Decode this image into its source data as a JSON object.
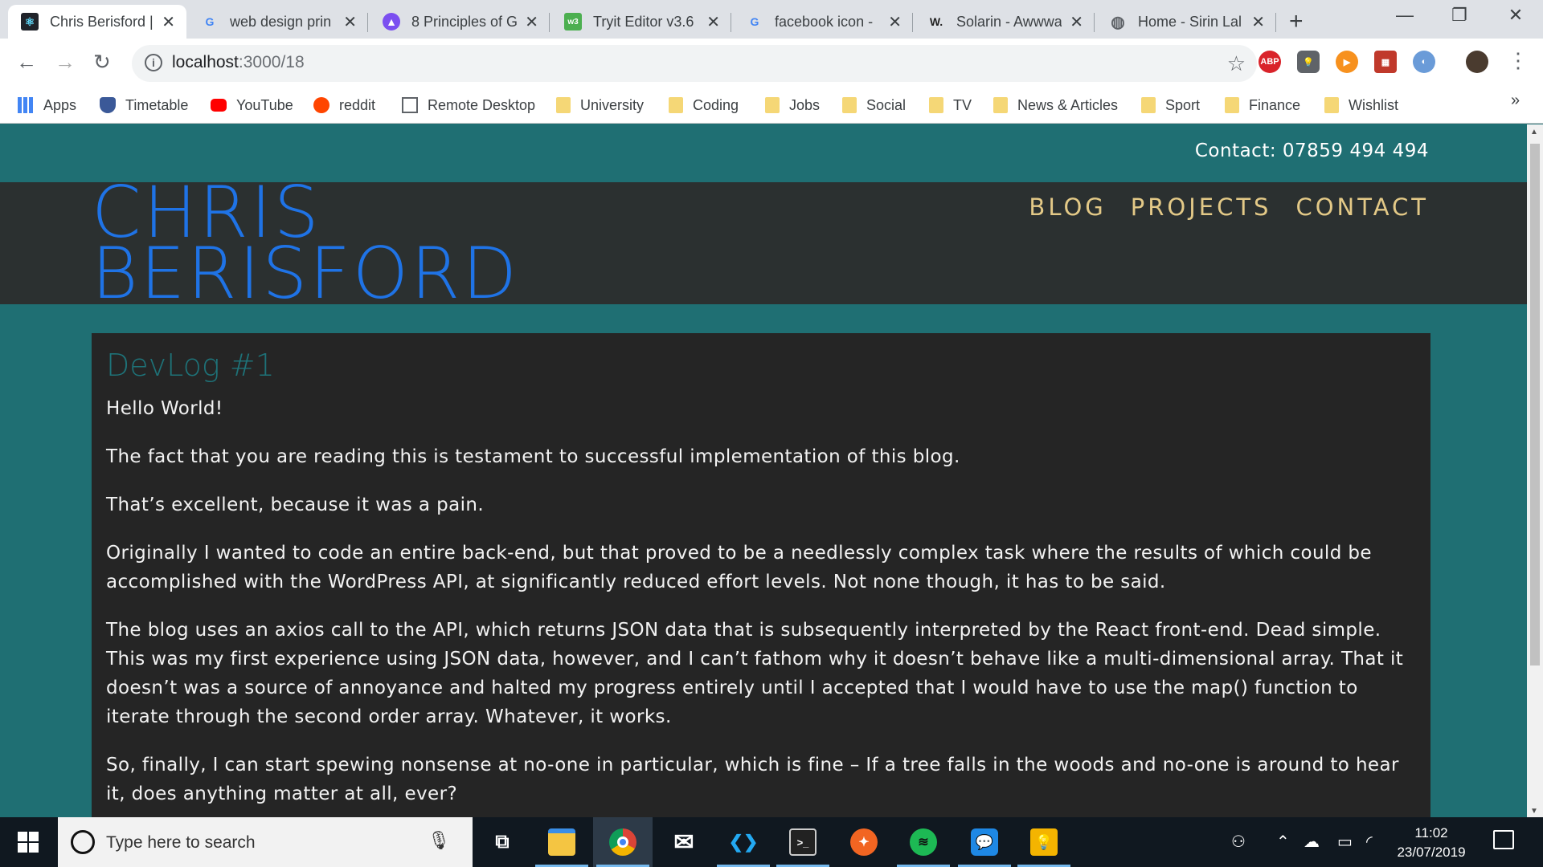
{
  "browser": {
    "tabs": [
      {
        "title": "Chris Berisford |",
        "favicon": "react-icon",
        "active": true
      },
      {
        "title": "web design prin",
        "favicon": "google-icon",
        "active": false
      },
      {
        "title": "8 Principles of G",
        "favicon": "triangle-logo-icon",
        "active": false
      },
      {
        "title": "Tryit Editor v3.6",
        "favicon": "w3schools-icon",
        "active": false
      },
      {
        "title": "facebook icon -",
        "favicon": "google-icon",
        "active": false
      },
      {
        "title": "Solarin - Awwwa",
        "favicon": "awwwards-icon",
        "active": false
      },
      {
        "title": "Home - Sirin Lal",
        "favicon": "globe-icon",
        "active": false
      }
    ],
    "new_tab": "+",
    "window_controls": {
      "minimize": "—",
      "restore": "❐",
      "close": "✕"
    },
    "url_host": "localhost",
    "url_path": ":3000/18",
    "extensions": [
      {
        "name": "adblock-plus-icon",
        "label": "ABP",
        "color": "#d9232a"
      },
      {
        "name": "lightbulb-extension-icon",
        "label": "💡",
        "color": "#5f6368"
      },
      {
        "name": "play-extension-icon",
        "label": "▶",
        "color": "#f7911e"
      },
      {
        "name": "grid-extension-icon",
        "label": "▦",
        "color": "#c0392b"
      },
      {
        "name": "round-extension-icon",
        "label": "◐",
        "color": "#6a9bd8"
      },
      {
        "name": "profile-avatar-icon",
        "label": "",
        "color": "#4a3b2f"
      }
    ],
    "bookmarks": [
      {
        "label": "Apps",
        "icon": "apps-grid-icon"
      },
      {
        "label": "Timetable",
        "icon": "shield-icon"
      },
      {
        "label": "YouTube",
        "icon": "youtube-icon"
      },
      {
        "label": "reddit",
        "icon": "reddit-icon"
      },
      {
        "label": "Remote Desktop",
        "icon": "remote-desktop-icon"
      },
      {
        "label": "University",
        "icon": "folder-icon"
      },
      {
        "label": "Coding",
        "icon": "folder-icon"
      },
      {
        "label": "Jobs",
        "icon": "folder-icon"
      },
      {
        "label": "Social",
        "icon": "folder-icon"
      },
      {
        "label": "TV",
        "icon": "folder-icon"
      },
      {
        "label": "News & Articles",
        "icon": "folder-icon"
      },
      {
        "label": "Sport",
        "icon": "folder-icon"
      },
      {
        "label": "Finance",
        "icon": "folder-icon"
      },
      {
        "label": "Wishlist",
        "icon": "folder-icon"
      }
    ],
    "bookmarks_more": "»"
  },
  "site": {
    "contact": "Contact: 07859 494 494",
    "name_line1": "CHRIS",
    "name_line2": "BERISFORD",
    "nav": [
      "BLOG",
      "PROJECTS",
      "CONTACT"
    ],
    "colors": {
      "teal": "#1f6f73",
      "header": "#2b3030",
      "name": "#1f73e6",
      "nav": "#e3c987"
    }
  },
  "post": {
    "title": "DevLog #1",
    "paragraphs": [
      "Hello World!",
      "The fact that you are reading this is testament to successful implementation of this blog.",
      "That’s excellent, because it was a pain.",
      "Originally I wanted to code an entire back-end, but that proved to be a needlessly complex task where the results of which could be accomplished with the WordPress API, at significantly reduced effort levels. Not none though, it has to be said.",
      "The blog uses an axios call to the API, which returns JSON data that is subsequently interpreted by the React front-end. Dead simple. This was my first experience using JSON data, however, and I can’t fathom why it doesn’t behave like a multi-dimensional array. That it doesn’t was a source of annoyance and halted my progress entirely until I accepted that I would have to use the map() function to iterate through the second order array. Whatever, it works.",
      "So, finally, I can start spewing nonsense at no-one in particular, which is fine – If a tree falls in the woods and no-one is around to hear it, does anything matter at all, ever?"
    ]
  },
  "taskbar": {
    "search_placeholder": "Type here to search",
    "apps": [
      {
        "name": "task-view-icon",
        "glyph": "⧉",
        "color": "transparent"
      },
      {
        "name": "file-explorer-icon",
        "glyph": "",
        "color": "#f4c542"
      },
      {
        "name": "chrome-icon",
        "glyph": "",
        "color": "#db4437"
      },
      {
        "name": "mail-icon",
        "glyph": "✉",
        "color": "transparent"
      },
      {
        "name": "vscode-icon",
        "glyph": "❮❯",
        "color": "#0078d4"
      },
      {
        "name": "terminal-icon",
        "glyph": ">_",
        "color": "#222222"
      },
      {
        "name": "compass-app-icon",
        "glyph": "✦",
        "color": "#f26522"
      },
      {
        "name": "spotify-icon",
        "glyph": "≋",
        "color": "#1db954"
      },
      {
        "name": "messaging-icon",
        "glyph": "💬",
        "color": "#1e88e5"
      },
      {
        "name": "keep-icon",
        "glyph": "💡",
        "color": "#f4b400"
      }
    ],
    "time": "11:02",
    "date": "23/07/2019"
  }
}
